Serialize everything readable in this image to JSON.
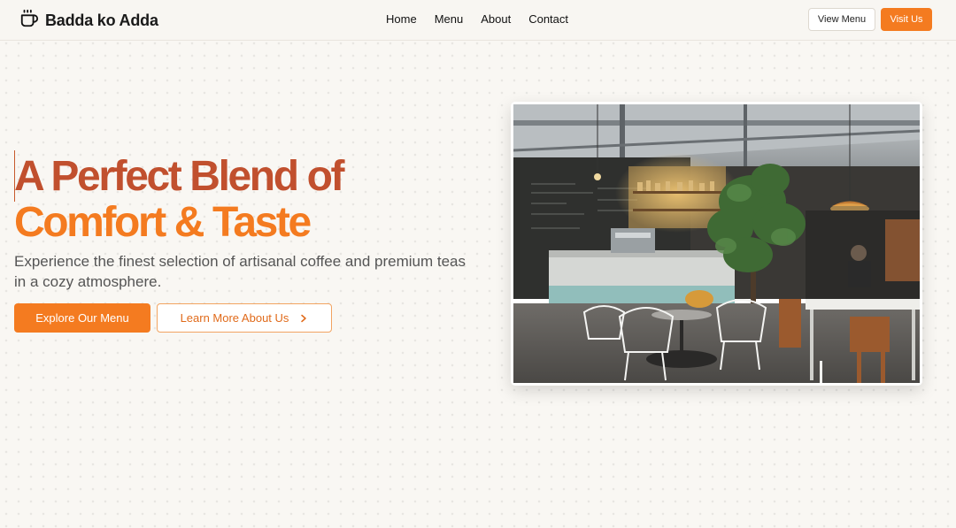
{
  "brand": {
    "name": "Badda ko Adda",
    "icon": "coffee-cup-icon"
  },
  "nav": {
    "links": [
      "Home",
      "Menu",
      "About",
      "Contact"
    ],
    "view_menu_label": "View Menu",
    "visit_label": "Visit Us"
  },
  "hero": {
    "headline_line1": "A Perfect Blend of",
    "headline_line2": "Comfort & Taste",
    "subtitle": "Experience the finest selection of artisanal coffee and premium teas in a cozy atmosphere.",
    "primary_cta": "Explore Our Menu",
    "secondary_cta": "Learn More About Us",
    "secondary_cta_icon": "chevron-right-icon",
    "image_alt": "cafe-interior-photo"
  },
  "colors": {
    "accent": "#f47b20",
    "headline_dark": "#c1502e",
    "background": "#f9f7f3"
  }
}
